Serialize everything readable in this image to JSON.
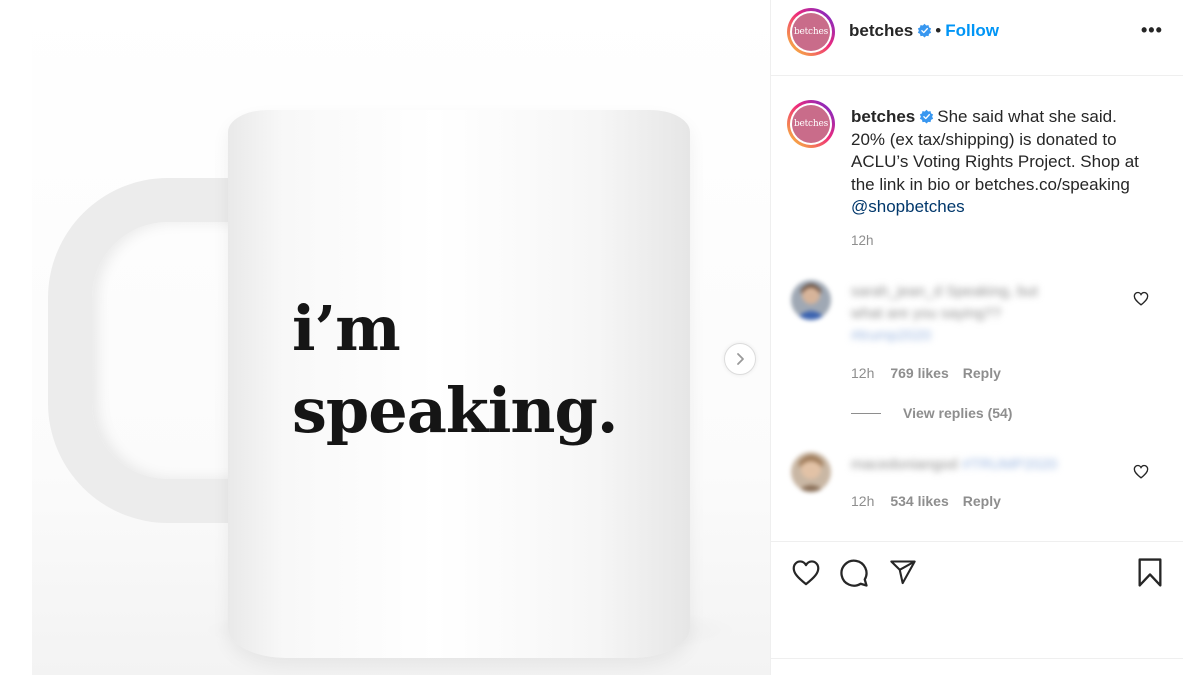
{
  "post": {
    "account": "betches",
    "avatar_text": "betches",
    "separator": "•",
    "follow_label": "Follow",
    "more_label": "•••",
    "verified_icon": "verified-badge-icon",
    "caption": {
      "username": "betches",
      "text": "She said what she said. 20% (ex tax/shipping) is donated to ACLU’s Voting Rights Project. Shop at the link in bio or betches.co/speaking",
      "mention": "@shopbetches",
      "time": "12h"
    }
  },
  "media": {
    "mug_text_line1": "i’m",
    "mug_text_line2": "speaking.",
    "next_icon": "chevron-right-icon"
  },
  "comments": [
    {
      "username": "sarah_jean_d",
      "text_line1": "sarah_jean_d Speaking, but",
      "text_line2": "what are you saying??",
      "text_line3": "#trump2020",
      "time": "12h",
      "likes": "769 likes",
      "reply": "Reply",
      "view_replies": "View replies (54)"
    },
    {
      "username": "macedoniangod",
      "text_line1": "macedoniangod",
      "tag": "#TRUMP2020",
      "time": "12h",
      "likes": "534 likes",
      "reply": "Reply"
    }
  ],
  "actions": {
    "like_icon": "heart-icon",
    "comment_icon": "comment-bubble-icon",
    "share_icon": "paper-plane-icon",
    "save_icon": "bookmark-icon"
  },
  "colors": {
    "link_blue": "#0095f6",
    "mention_blue": "#00376b",
    "muted": "#8e8e8e",
    "text": "#262626",
    "brand_pink": "#c96c8a"
  }
}
